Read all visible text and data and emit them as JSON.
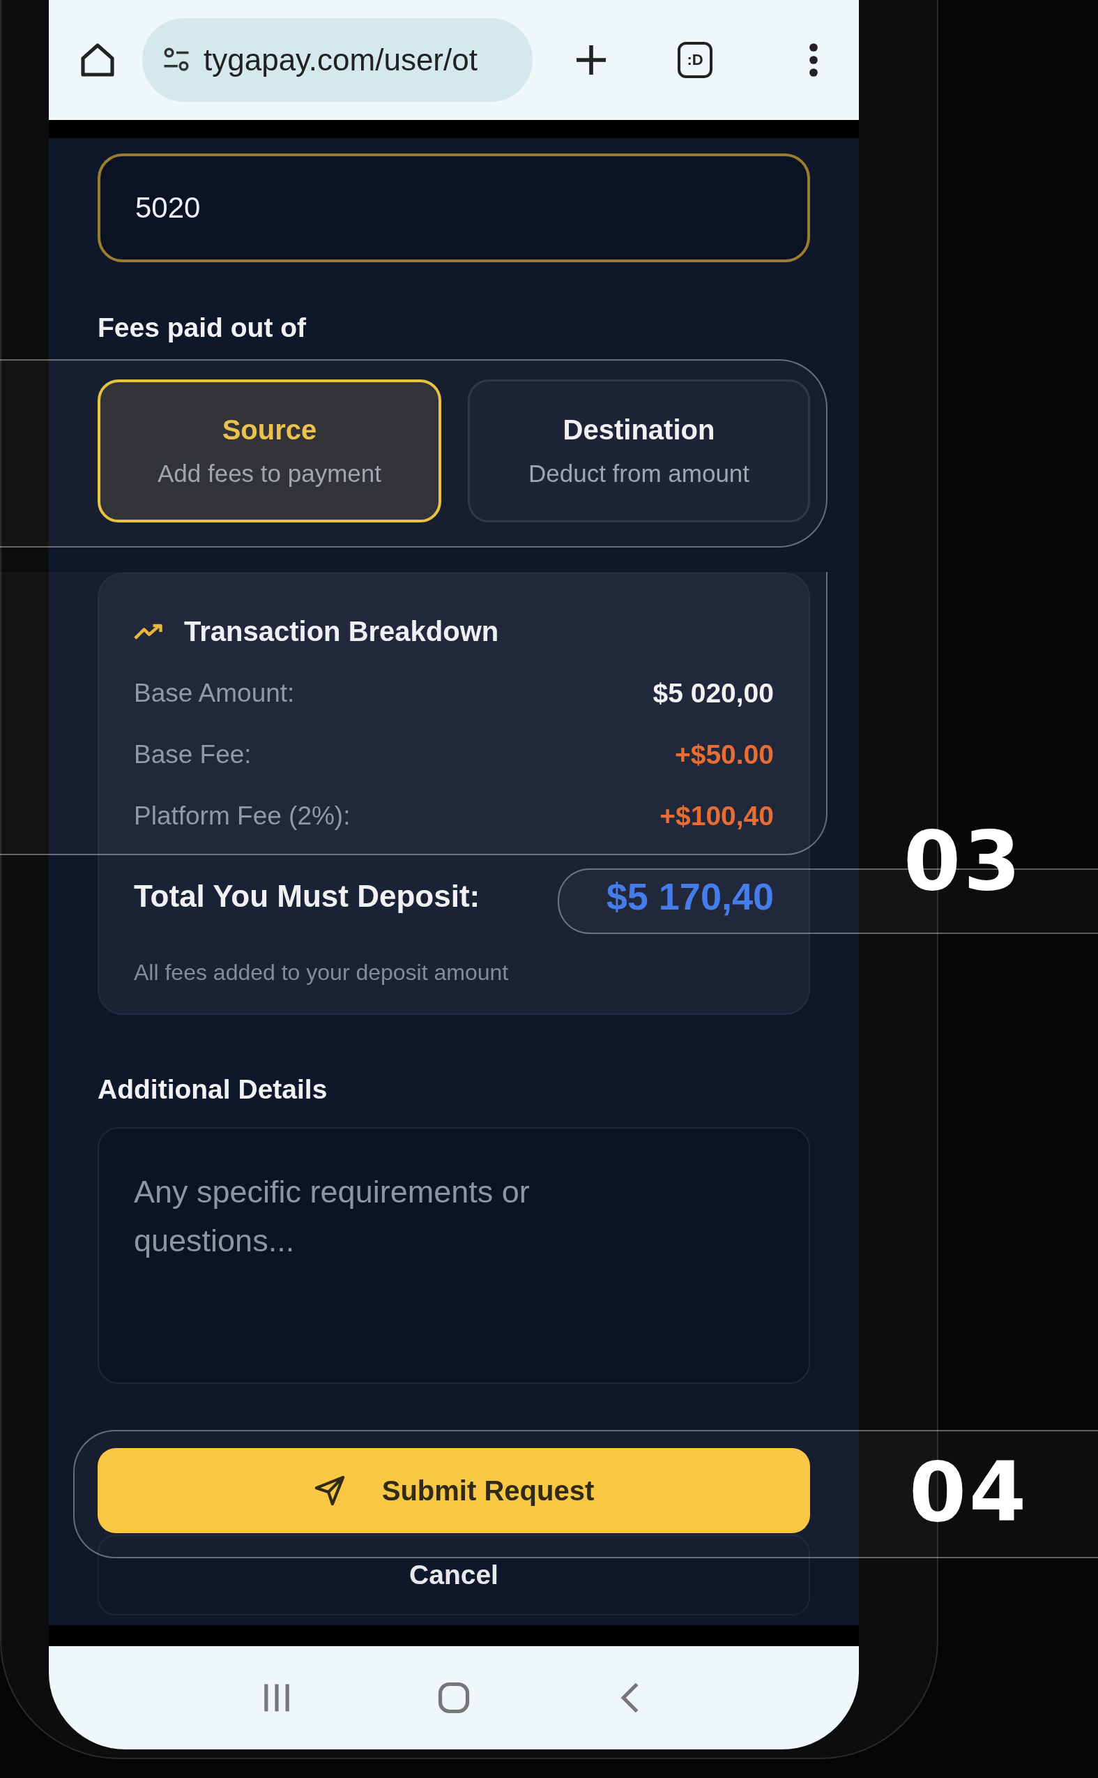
{
  "browser": {
    "url": "tygapay.com/user/ot",
    "tab_count": ":D"
  },
  "amount_field": {
    "value": "5020"
  },
  "fees": {
    "label": "Fees paid out of",
    "options": [
      {
        "title": "Source",
        "subtitle": "Add fees to payment",
        "selected": true
      },
      {
        "title": "Destination",
        "subtitle": "Deduct from amount",
        "selected": false
      }
    ]
  },
  "breakdown": {
    "title": "Transaction Breakdown",
    "rows": [
      {
        "label": "Base Amount:",
        "value": "$5 020,00",
        "kind": "base"
      },
      {
        "label": "Base Fee:",
        "value": "+$50.00",
        "kind": "fee"
      },
      {
        "label": "Platform Fee (2%):",
        "value": "+$100,40",
        "kind": "fee"
      }
    ],
    "total_label": "Total You Must Deposit:",
    "total_value": "$5 170,40",
    "note": "All fees added to your deposit amount"
  },
  "details": {
    "label": "Additional Details",
    "placeholder": "Any specific requirements or questions..."
  },
  "buttons": {
    "submit": "Submit Request",
    "cancel": "Cancel"
  },
  "callouts": [
    "03",
    "04"
  ]
}
